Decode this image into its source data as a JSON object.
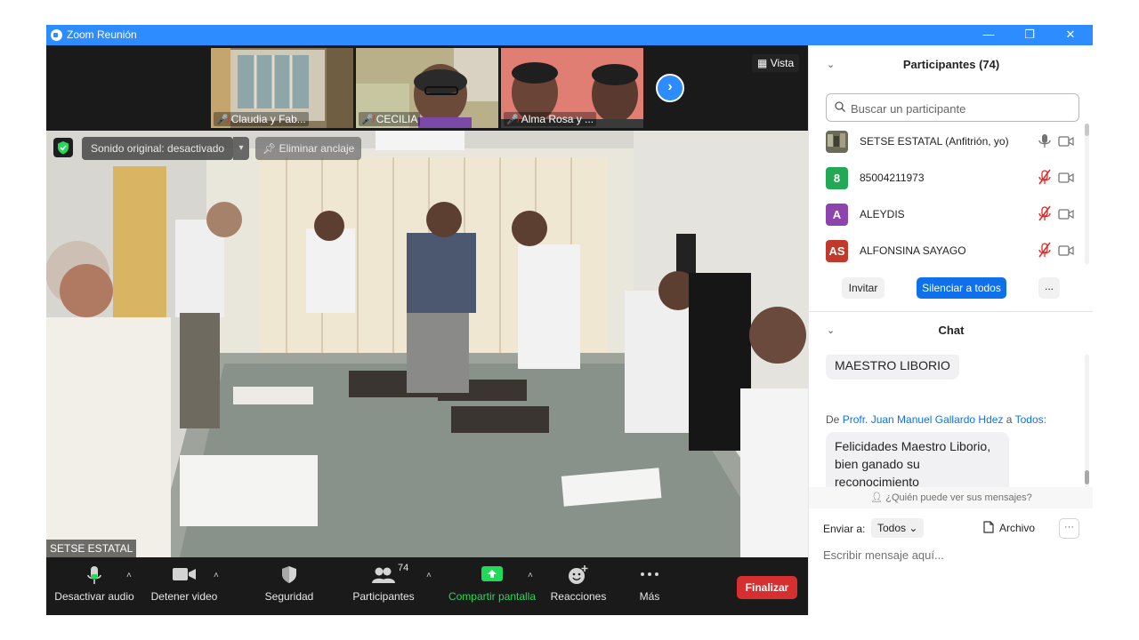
{
  "window": {
    "title": "Zoom Reunión",
    "controls": {
      "minimize": "—",
      "restore": "❐",
      "close": "✕"
    }
  },
  "thumbnails": [
    {
      "label": "Claudia y Fab...",
      "mic": "muted"
    },
    {
      "label": "CECILIA",
      "mic": "muted"
    },
    {
      "label": "Alma Rosa y ...",
      "mic": "muted"
    }
  ],
  "view_button": "Vista",
  "main_video": {
    "sound_pill": "Sonido original: desactivado",
    "unpin_pill": "Eliminar anclaje",
    "speaker_name": "SETSE ESTATAL"
  },
  "toolbar": {
    "mute_audio": "Desactivar audio",
    "stop_video": "Detener video",
    "security": "Seguridad",
    "participants": "Participantes",
    "participants_count": "74",
    "share_screen": "Compartir pantalla",
    "reactions": "Reacciones",
    "more": "Más",
    "end": "Finalizar"
  },
  "participants_panel": {
    "title": "Participantes (74)",
    "search_placeholder": "Buscar un participante",
    "list": [
      {
        "initials": "",
        "name": "SETSE ESTATAL (Anfitrión, yo)",
        "avatar_color": "#6b6b5a",
        "mic": "on"
      },
      {
        "initials": "8",
        "name": "85004211973",
        "avatar_color": "#23a855",
        "mic": "muted"
      },
      {
        "initials": "A",
        "name": "ALEYDIS",
        "avatar_color": "#8e44ad",
        "mic": "muted"
      },
      {
        "initials": "AS",
        "name": "ALFONSINA SAYAGO",
        "avatar_color": "#c0392b",
        "mic": "muted"
      }
    ],
    "invite": "Invitar",
    "mute_all": "Silenciar a todos",
    "more": "..."
  },
  "chat_panel": {
    "title": "Chat",
    "messages": [
      {
        "text": "MAESTRO LIBORIO"
      },
      {
        "from_prefix": "De",
        "from": "Profr. Juan Manuel Gallardo Hdez",
        "to_prefix": "a",
        "to": "Todos:",
        "text_lines": [
          "Felicidades Maestro Liborio,",
          "bien ganado su",
          "reconocimiento"
        ]
      }
    ],
    "who_can_see": "¿Quién puede ver sus mensajes?",
    "send_to_label": "Enviar a:",
    "send_to_value": "Todos",
    "file_button": "Archivo",
    "more": "···",
    "input_placeholder": "Escribir mensaje aquí..."
  },
  "colors": {
    "zoom_blue": "#2d8cff",
    "primary_button": "#0e71eb",
    "end_red": "#d62f2f",
    "share_green": "#23d959",
    "muted_red": "#e02828"
  }
}
